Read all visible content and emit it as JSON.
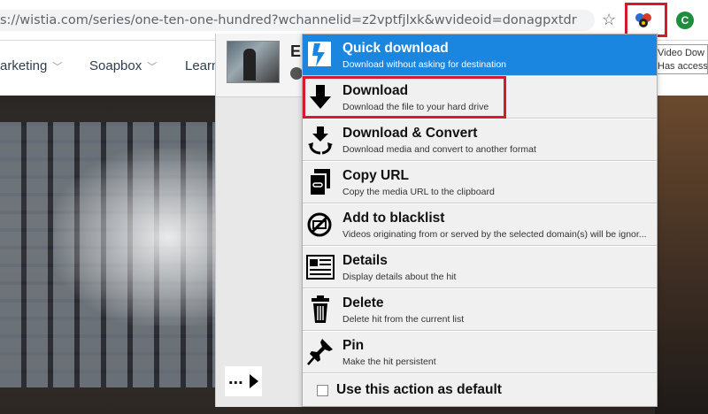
{
  "browser": {
    "url": "s://wistia.com/series/one-ten-one-hundred?wchannelid=z2vptfjlxk&wvideoid=donagpxtdr",
    "profile_initial": "C"
  },
  "site_nav": {
    "items": [
      {
        "label": "arketing"
      },
      {
        "label": "Soapbox"
      },
      {
        "label": "Learn"
      }
    ]
  },
  "tooltip": {
    "line1": "Video Dow",
    "line2": "Has access"
  },
  "popup": {
    "hit_title": "E",
    "more_label": "..."
  },
  "actions": [
    {
      "title": "Quick download",
      "desc": "Download without asking for destination",
      "icon": "quick-download-icon"
    },
    {
      "title": "Download",
      "desc": "Download the file to your hard drive",
      "icon": "download-arrow-icon"
    },
    {
      "title": "Download & Convert",
      "desc": "Download media and convert to another format",
      "icon": "download-convert-icon"
    },
    {
      "title": "Copy URL",
      "desc": "Copy the media URL to the clipboard",
      "icon": "copy-url-icon"
    },
    {
      "title": "Add to blacklist",
      "desc": "Videos originating from or served by the selected domain(s) will be ignor...",
      "icon": "blacklist-icon"
    },
    {
      "title": "Details",
      "desc": "Display details about the hit",
      "icon": "details-icon"
    },
    {
      "title": "Delete",
      "desc": "Delete hit from the current list",
      "icon": "trash-icon"
    },
    {
      "title": "Pin",
      "desc": "Make the hit persistent",
      "icon": "pin-icon"
    }
  ],
  "default_action": {
    "label": "Use this action as default",
    "checked": false
  },
  "colors": {
    "accent": "#1a86e0",
    "highlight": "#d51a2b"
  }
}
